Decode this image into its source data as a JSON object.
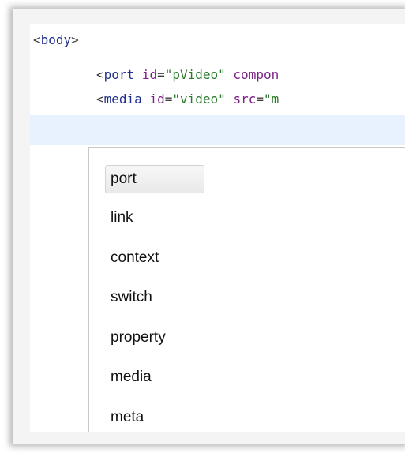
{
  "editor": {
    "lines": [
      {
        "open": "<",
        "tag": "body",
        "close": ">"
      },
      {
        "open": "<",
        "tag": "port",
        "attr1": "id",
        "eq1": "=",
        "str1": "\"pVideo\"",
        "attr2": "compon"
      },
      {
        "open": "<",
        "tag": "media",
        "attr1": "id",
        "eq1": "=",
        "str1": "\"video\"",
        "attr2": "src",
        "eq2": "=",
        "str2": "\"m"
      }
    ]
  },
  "autocomplete": {
    "items": [
      {
        "label": "port",
        "selected": true
      },
      {
        "label": "link",
        "selected": false
      },
      {
        "label": "context",
        "selected": false
      },
      {
        "label": "switch",
        "selected": false
      },
      {
        "label": "property",
        "selected": false
      },
      {
        "label": "media",
        "selected": false
      },
      {
        "label": "meta",
        "selected": false
      }
    ]
  },
  "colors": {
    "tag": "#1f2f8f",
    "attribute": "#7a1f86",
    "string": "#2a7a2a",
    "current_line": "#e8f2fe"
  }
}
